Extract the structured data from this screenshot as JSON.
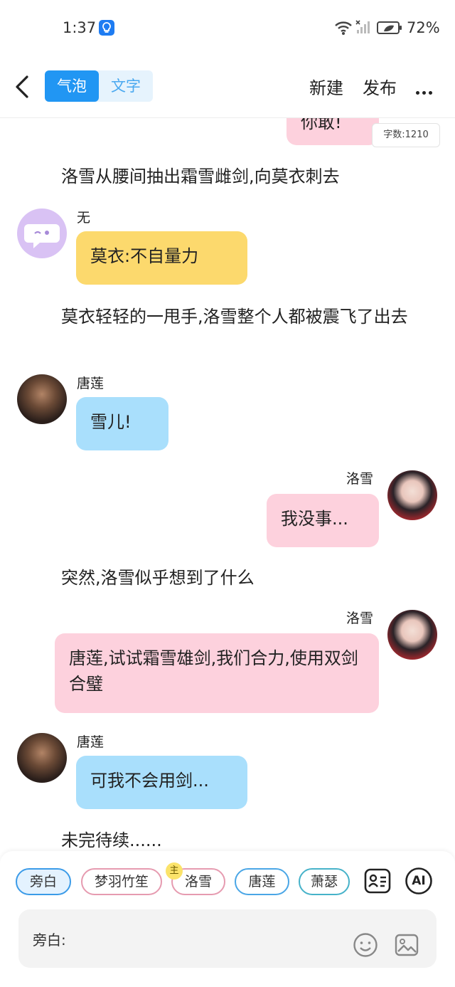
{
  "status_bar": {
    "time": "1:37",
    "battery_percent": "72%"
  },
  "header": {
    "tab_bubble": "气泡",
    "tab_text": "文字",
    "new_label": "新建",
    "publish_label": "发布"
  },
  "chat": {
    "top_bubble_fragment": "你敢!",
    "word_count": "字数:1210",
    "narration_1": "洛雪从腰间抽出霜雪雌剑,向莫衣刺去",
    "msg_wu": {
      "name": "无",
      "text": "莫衣:不自量力"
    },
    "narration_2": "莫衣轻轻的一甩手,洛雪整个人都被震飞了出去",
    "msg_tanglian_1": {
      "name": "唐莲",
      "text": "雪儿!"
    },
    "msg_luoxue_1": {
      "name": "洛雪",
      "text": "我没事..."
    },
    "narration_3": "突然,洛雪似乎想到了什么",
    "msg_luoxue_2": {
      "name": "洛雪",
      "text": "唐莲,试试霜雪雄剑,我们合力,使用双剑合璧"
    },
    "msg_tanglian_2": {
      "name": "唐莲",
      "text": "可我不会用剑..."
    },
    "narration_4": "未完待续......"
  },
  "role_bar": {
    "roles": [
      "旁白",
      "梦羽竹笙",
      "洛雪",
      "唐莲",
      "萧瑟"
    ],
    "main_badge": "主",
    "ai_label": "AI"
  },
  "input": {
    "prefix": "旁白:"
  },
  "colors": {
    "accent": "#2196f3",
    "pink_bubble": "#fdd1dd",
    "yellow_bubble": "#fcd96d",
    "blue_bubble": "#a9dffc"
  }
}
